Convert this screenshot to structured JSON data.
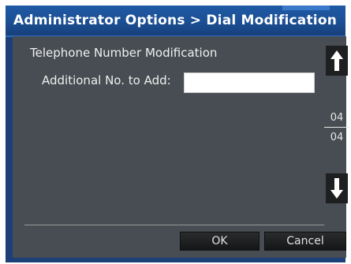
{
  "window": {
    "title": "Administrator Options > Dial Modification"
  },
  "form": {
    "section_title": "Telephone Number Modification",
    "additional_label": "Additional No. to Add:",
    "additional_value": ""
  },
  "pager": {
    "current": "04",
    "total": "04"
  },
  "buttons": {
    "ok_label": "OK",
    "cancel_label": "Cancel"
  },
  "icons": {
    "scroll_up": "up-arrow-icon",
    "scroll_down": "down-arrow-icon"
  },
  "colors": {
    "title_bar": "#1b4f93",
    "panel": "#474d52",
    "button": "#1e1f20"
  }
}
